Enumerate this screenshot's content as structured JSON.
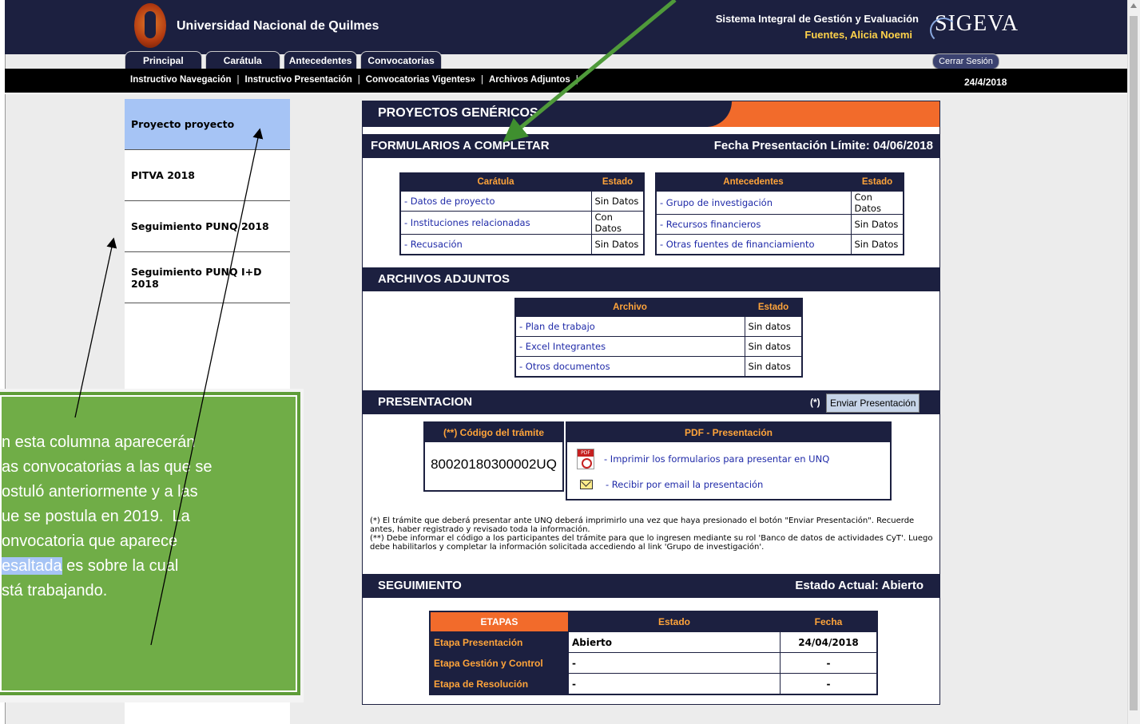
{
  "header": {
    "university": "Universidad Nacional de Quilmes",
    "system": "Sistema Integral de Gestión y Evaluación",
    "user": "Fuentes, Alicia Noemi",
    "brand": "SIGEVA",
    "logout": "Cerrar Sesión"
  },
  "tabs": [
    "Principal",
    "Carátula",
    "Antecedentes",
    "Convocatorias"
  ],
  "subnav": {
    "items": [
      "Instructivo Navegación",
      "Instructivo Presentación",
      "Convocatorias Vigentes»",
      "Archivos Adjuntos"
    ],
    "date": "24/4/2018"
  },
  "sidebar": {
    "items": [
      "Proyecto proyecto",
      "PITVA 2018",
      "Seguimiento PUNQ 2018",
      "Seguimiento PUNQ I+D 2018"
    ]
  },
  "main": {
    "title": "PROYECTOS GENÉRICOS",
    "forms": {
      "heading": "FORMULARIOS A COMPLETAR",
      "deadline": "Fecha Presentación Límite: 04/06/2018",
      "caratula": {
        "headers": [
          "Carátula",
          "Estado"
        ],
        "rows": [
          {
            "item": "- Datos de proyecto",
            "status": "Sin Datos"
          },
          {
            "item": "- Instituciones relacionadas",
            "status": "Con Datos"
          },
          {
            "item": "- Recusación",
            "status": "Sin Datos"
          }
        ]
      },
      "antecedentes": {
        "headers": [
          "Antecedentes",
          "Estado"
        ],
        "rows": [
          {
            "item": "- Grupo de investigación",
            "status": "Con Datos"
          },
          {
            "item": "- Recursos financieros",
            "status": "Sin Datos"
          },
          {
            "item": "- Otras fuentes de financiamiento",
            "status": "Sin Datos"
          }
        ]
      }
    },
    "attachments": {
      "heading": "ARCHIVOS ADJUNTOS",
      "headers": [
        "Archivo",
        "Estado"
      ],
      "rows": [
        {
          "item": "- Plan de trabajo",
          "status": "Sin datos"
        },
        {
          "item": "- Excel Integrantes",
          "status": "Sin datos"
        },
        {
          "item": "- Otros documentos",
          "status": "Sin datos"
        }
      ]
    },
    "presentation": {
      "heading": "PRESENTACION",
      "mark": "(*)",
      "send_button": "Enviar Presentación",
      "code_header": "(**) Código del trámite",
      "code": "80020180300002UQ",
      "pdf_header": "PDF - Presentación",
      "print_link": "- Imprimir los formularios para presentar en UNQ",
      "email_link": "- Recibir por email la presentación",
      "note1": "(*) El trámite que deberá presentar ante UNQ deberá imprimirlo una vez que haya presionado el botón \"Enviar Presentación\". Recuerde antes, haber registrado y revisado toda la información.",
      "note2": "(**) Debe informar el código a los participantes del trámite para que lo ingresen mediante su rol 'Banco de datos de actividades CyT'. Luego debe habilitarlos y completar la información solicitada accediendo al link 'Grupo de investigación'."
    },
    "tracking": {
      "heading": "SEGUIMIENTO",
      "state": "Estado Actual:  Abierto",
      "headers": [
        "ETAPAS",
        "Estado",
        "Fecha"
      ],
      "rows": [
        {
          "stage": "Etapa Presentación",
          "status": "Abierto",
          "date": "24/04/2018"
        },
        {
          "stage": "Etapa Gestión y Control",
          "status": "-",
          "date": "-"
        },
        {
          "stage": "Etapa de Resolución",
          "status": "-",
          "date": "-"
        }
      ]
    }
  },
  "annotation": {
    "lines": [
      "n esta columna aparecerán",
      "as convocatorias a las que se",
      "ostuló anteriormente y a las",
      "ue se postula en 2019.  La",
      "onvocatoria que aparece",
      "esaltada",
      " es sobre la cual",
      "stá trabajando."
    ]
  },
  "colors": {
    "navy": "#1c2040",
    "orange": "#f26b2b",
    "gold": "#ffa43a",
    "highlight": "#a6c4f5",
    "callout": "#70ad47"
  }
}
